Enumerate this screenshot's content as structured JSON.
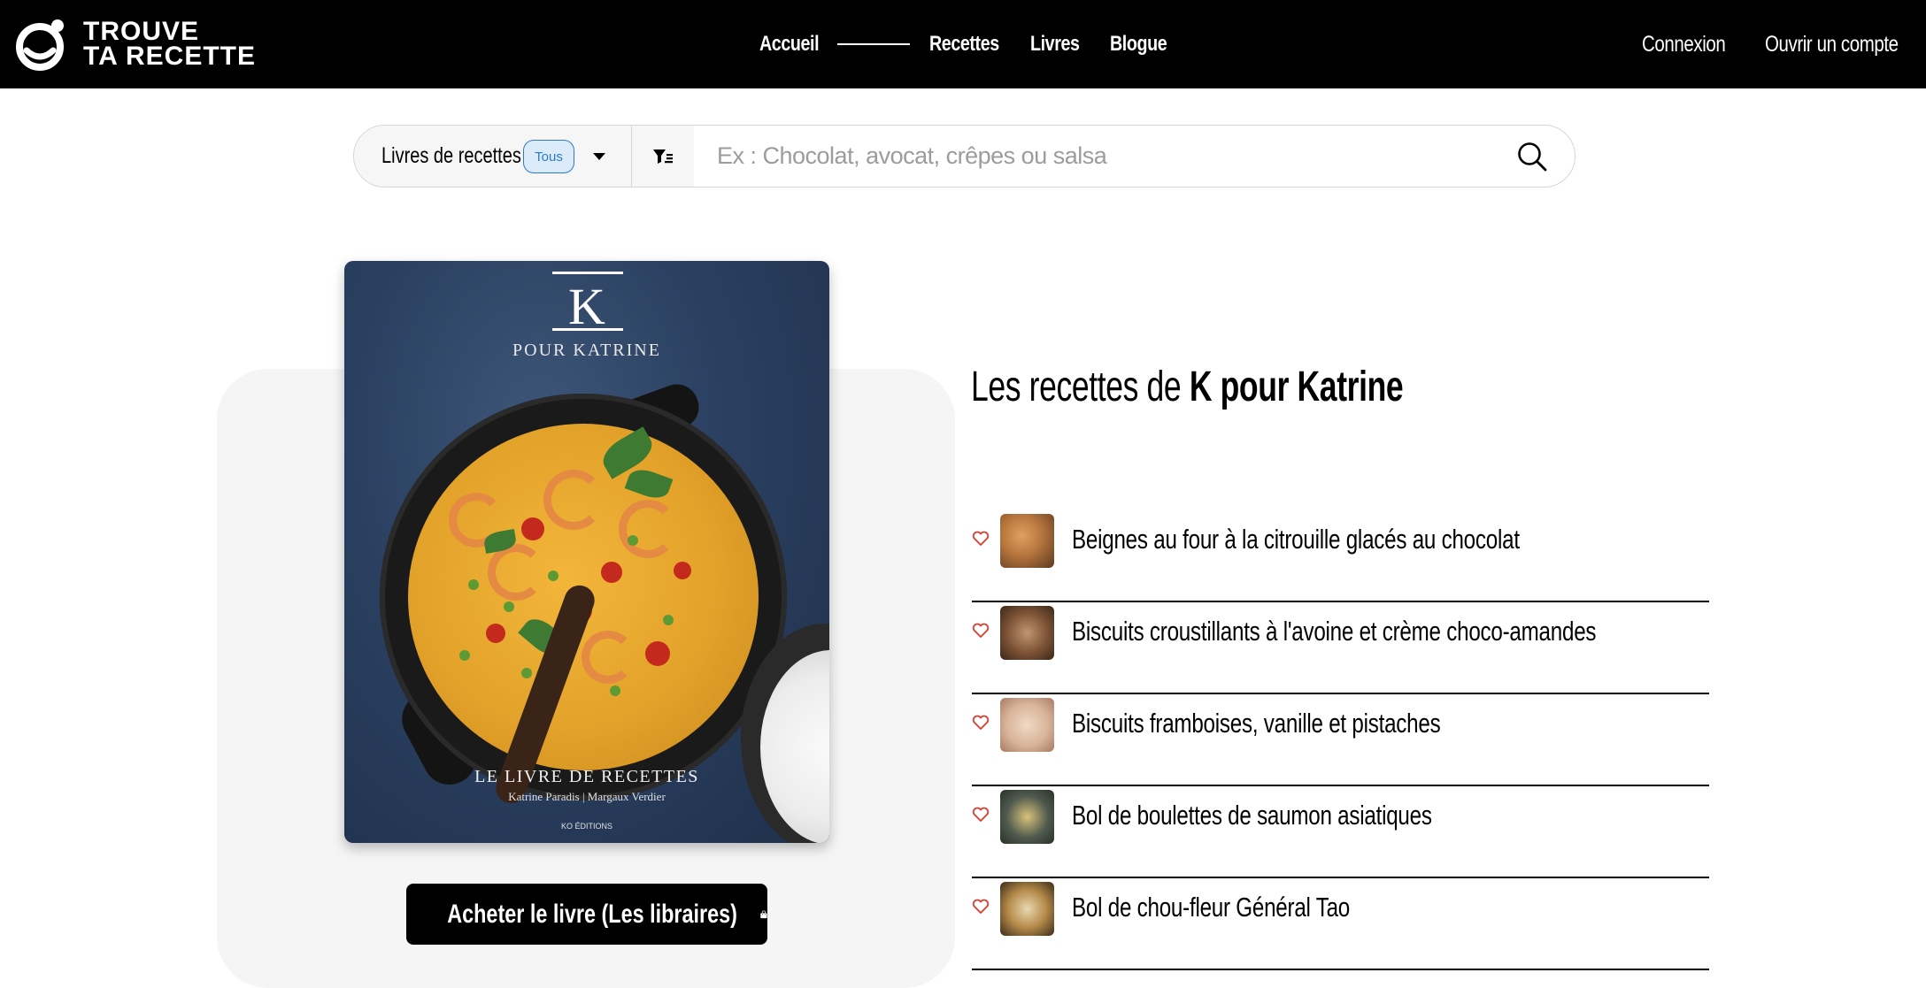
{
  "brand": {
    "line1": "TROUVE",
    "line2": "TA RECETTE"
  },
  "nav": {
    "home": "Accueil",
    "recipes": "Recettes",
    "books": "Livres",
    "blog": "Blogue",
    "login": "Connexion",
    "signup": "Ouvrir un compte"
  },
  "search": {
    "type_label": "Livres de recettes",
    "badge": "Tous",
    "placeholder": "Ex : Chocolat, avocat, crêpes ou salsa"
  },
  "book": {
    "cover": {
      "letter": "K",
      "subtitle": "POUR KATRINE",
      "title": "LE LIVRE DE RECETTES",
      "authors": "Katrine Paradis | Margaux Verdier",
      "publisher": "KO ÉDITIONS"
    },
    "buy_label": "Acheter le livre (Les libraires)"
  },
  "heading": {
    "prefix": "Les recettes de ",
    "name": "K pour Katrine"
  },
  "recipes": [
    {
      "title": "Beignes au four à la citrouille glacés au chocolat",
      "thumb_color": "#b5743d"
    },
    {
      "title": "Biscuits croustillants à l'avoine et crème choco-amandes",
      "thumb_color": "#7a5135"
    },
    {
      "title": "Biscuits framboises, vanille et pistaches",
      "thumb_color": "#d8b49a"
    },
    {
      "title": "Bol de boulettes de saumon asiatiques",
      "thumb_color": "#4f5a4e"
    },
    {
      "title": "Bol de chou-fleur Général Tao",
      "thumb_color": "#6b5432"
    }
  ],
  "colors": {
    "accent": "#2d79c7",
    "heart": "#e03a2f",
    "nav_bg": "#000000"
  }
}
